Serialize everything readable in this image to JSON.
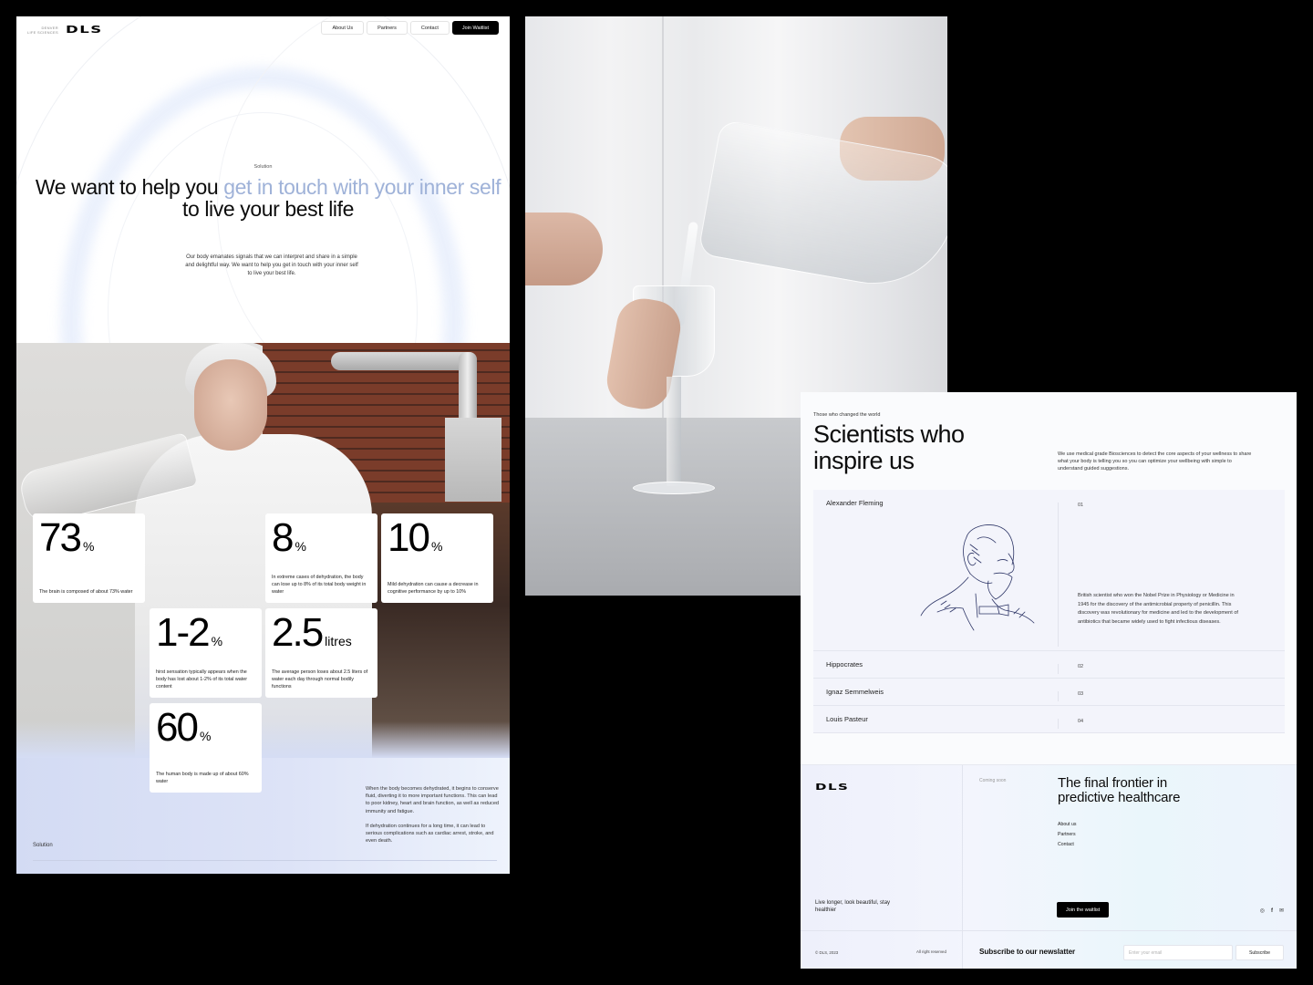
{
  "landing": {
    "brand": {
      "logo": "DLS",
      "subtitle_line1": "DENVER",
      "subtitle_line2": "LIFE SCIENCES"
    },
    "nav": {
      "items": [
        "About Us",
        "Partners",
        "Contact"
      ],
      "cta": "Join Waitlist"
    },
    "hero": {
      "eyebrow": "Solution",
      "title_part1": "We want to help you ",
      "title_accent": "get in touch with your inner self",
      "title_part2": "to live your best life",
      "body": "Our body emanates signals that we can interpret and share in a simple and delightful way.  We want to help you get in touch with your inner self to live your best life."
    },
    "stats": [
      {
        "value": "73",
        "unit": "%",
        "description": "The brain is composed of about 73% water"
      },
      {
        "value": "8",
        "unit": "%",
        "description": "In extreme cases of dehydration, the body can lose up to 8% of its total body weight in water"
      },
      {
        "value": "10",
        "unit": "%",
        "description": "Mild dehydration can cause a decrease in cognitive performance by up to 10%"
      },
      {
        "value": "1-2",
        "unit": "%",
        "description": "hirst sensation typically appears when the body has lost about 1-2% of its total water content"
      },
      {
        "value": "2.5",
        "unit": "litres",
        "description": "The average person loses about 2.5 liters of water each day through normal bodily functions"
      },
      {
        "value": "60",
        "unit": "%",
        "description": "The human body is made up of about 60% water"
      }
    ],
    "solution_section": {
      "label": "Solution",
      "paragraph1": "When the body becomes dehydrated, it begins to conserve fluid, diverting it to more important functions. This can lead to poor kidney, heart and brain function, as well as reduced immunity and fatigue.",
      "paragraph2": "If dehydration continues for a long time, it can lead to serious complications such as cardiac arrest, stroke, and even death."
    }
  },
  "scientists_page": {
    "eyebrow": "Those who changed the world",
    "title_line1": "Scientists who",
    "title_line2": "inspire us",
    "intro": "We use medical grade Biosciences to detect the core aspects of your wellness to share what your body is telling you so you can optimize your wellbeing with simple to understand guided suggestions.",
    "scientists": [
      {
        "name": "Alexander Fleming",
        "index": "01",
        "expanded": true,
        "bio": "British scientist who won the Nobel Prize in Physiology or Medicine in 1945 for the discovery of the antimicrobial property of penicillin. This discovery was revolutionary for medicine and led to the development of antibiotics that became widely used to fight infectious diseases.",
        "illustration": "portrait-sketch"
      },
      {
        "name": "Hippocrates",
        "index": "02",
        "expanded": false
      },
      {
        "name": "Ignaz Semmelweis",
        "index": "03",
        "expanded": false
      },
      {
        "name": "Louis Pasteur",
        "index": "04",
        "expanded": false
      }
    ],
    "footer": {
      "logo": "DLS",
      "coming_soon": "Coming soon",
      "title_line1": "The final frontier in",
      "title_line2": "predictive healthcare",
      "links": [
        "About us",
        "Partners",
        "Contact"
      ],
      "tagline": "Live longer, look beautiful, stay healthier",
      "cta": "Join the waitlist",
      "socials": [
        {
          "name": "instagram-icon",
          "glyph": "◎"
        },
        {
          "name": "facebook-icon",
          "glyph": "f"
        },
        {
          "name": "mail-icon",
          "glyph": "✉"
        }
      ],
      "copyright": "© DLS, 2023",
      "rights": "All right reserved",
      "newsletter_title": "Subscribe to our newslatter",
      "email_placeholder": "Enter your email",
      "email_value": "",
      "subscribe_label": "Subscribe"
    }
  },
  "colors": {
    "accent": "#9fb2d8",
    "dark_button": "#000000",
    "page_background": "#000000"
  }
}
